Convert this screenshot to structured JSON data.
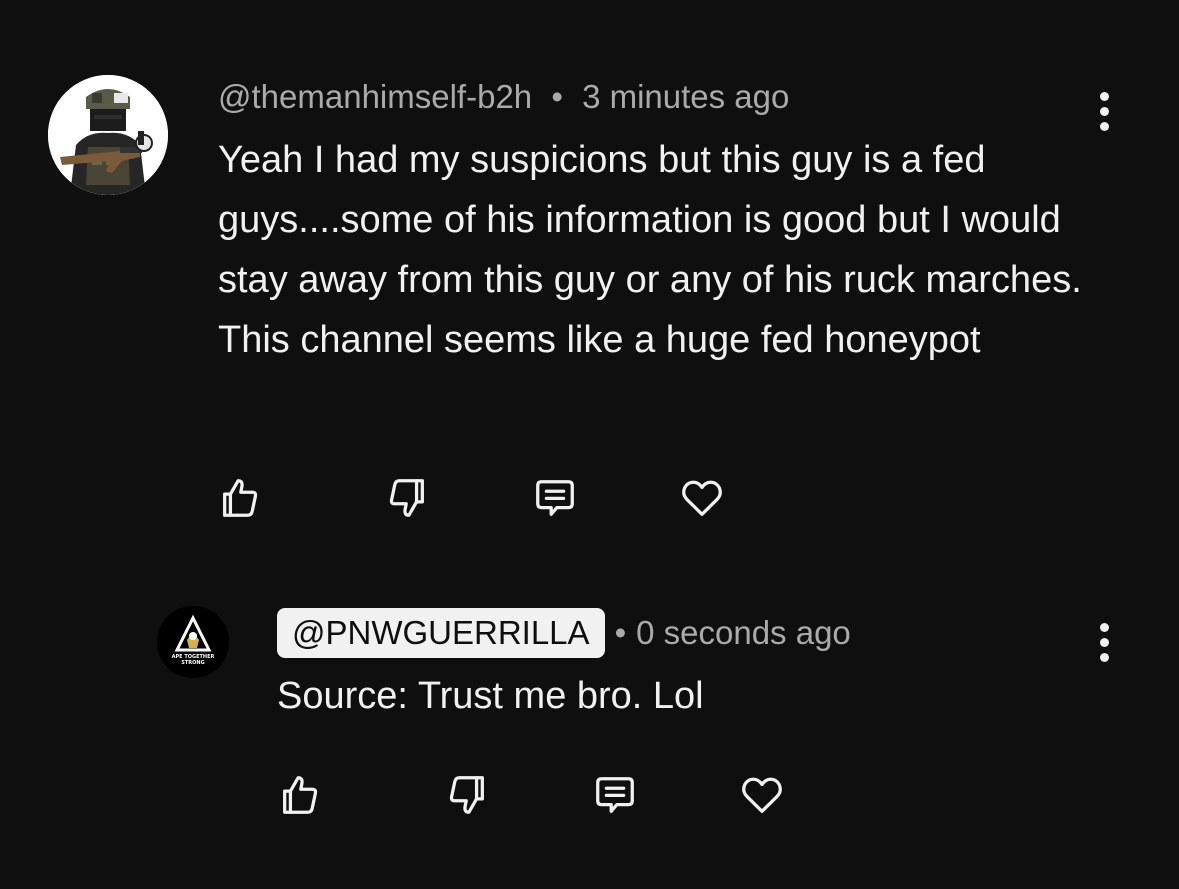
{
  "comments": [
    {
      "handle": "@themanhimself-b2h",
      "separator": "•",
      "timestamp": "3 minutes ago",
      "text": "Yeah I had my suspicions but this guy is a fed guys....some of his information is good but I would stay away from this guy or any of his ruck marches. This channel seems like a huge fed honeypot",
      "actions": [
        "thumbs-up-icon",
        "thumbs-down-icon",
        "reply-icon",
        "heart-icon"
      ]
    },
    {
      "handle": "@PNWGUERRILLA",
      "separator": "•",
      "timestamp": "0 seconds ago",
      "text": "Source: Trust me bro. Lol",
      "avatar_text": [
        "APE TOGETHER",
        "STRONG"
      ],
      "actions": [
        "thumbs-up-icon",
        "thumbs-down-icon",
        "reply-icon",
        "heart-icon"
      ]
    }
  ],
  "colors": {
    "background": "#0f0f0f",
    "text_primary": "#f1f1f1",
    "text_secondary": "#aaaaaa",
    "pill_bg": "#f1f1f1"
  }
}
